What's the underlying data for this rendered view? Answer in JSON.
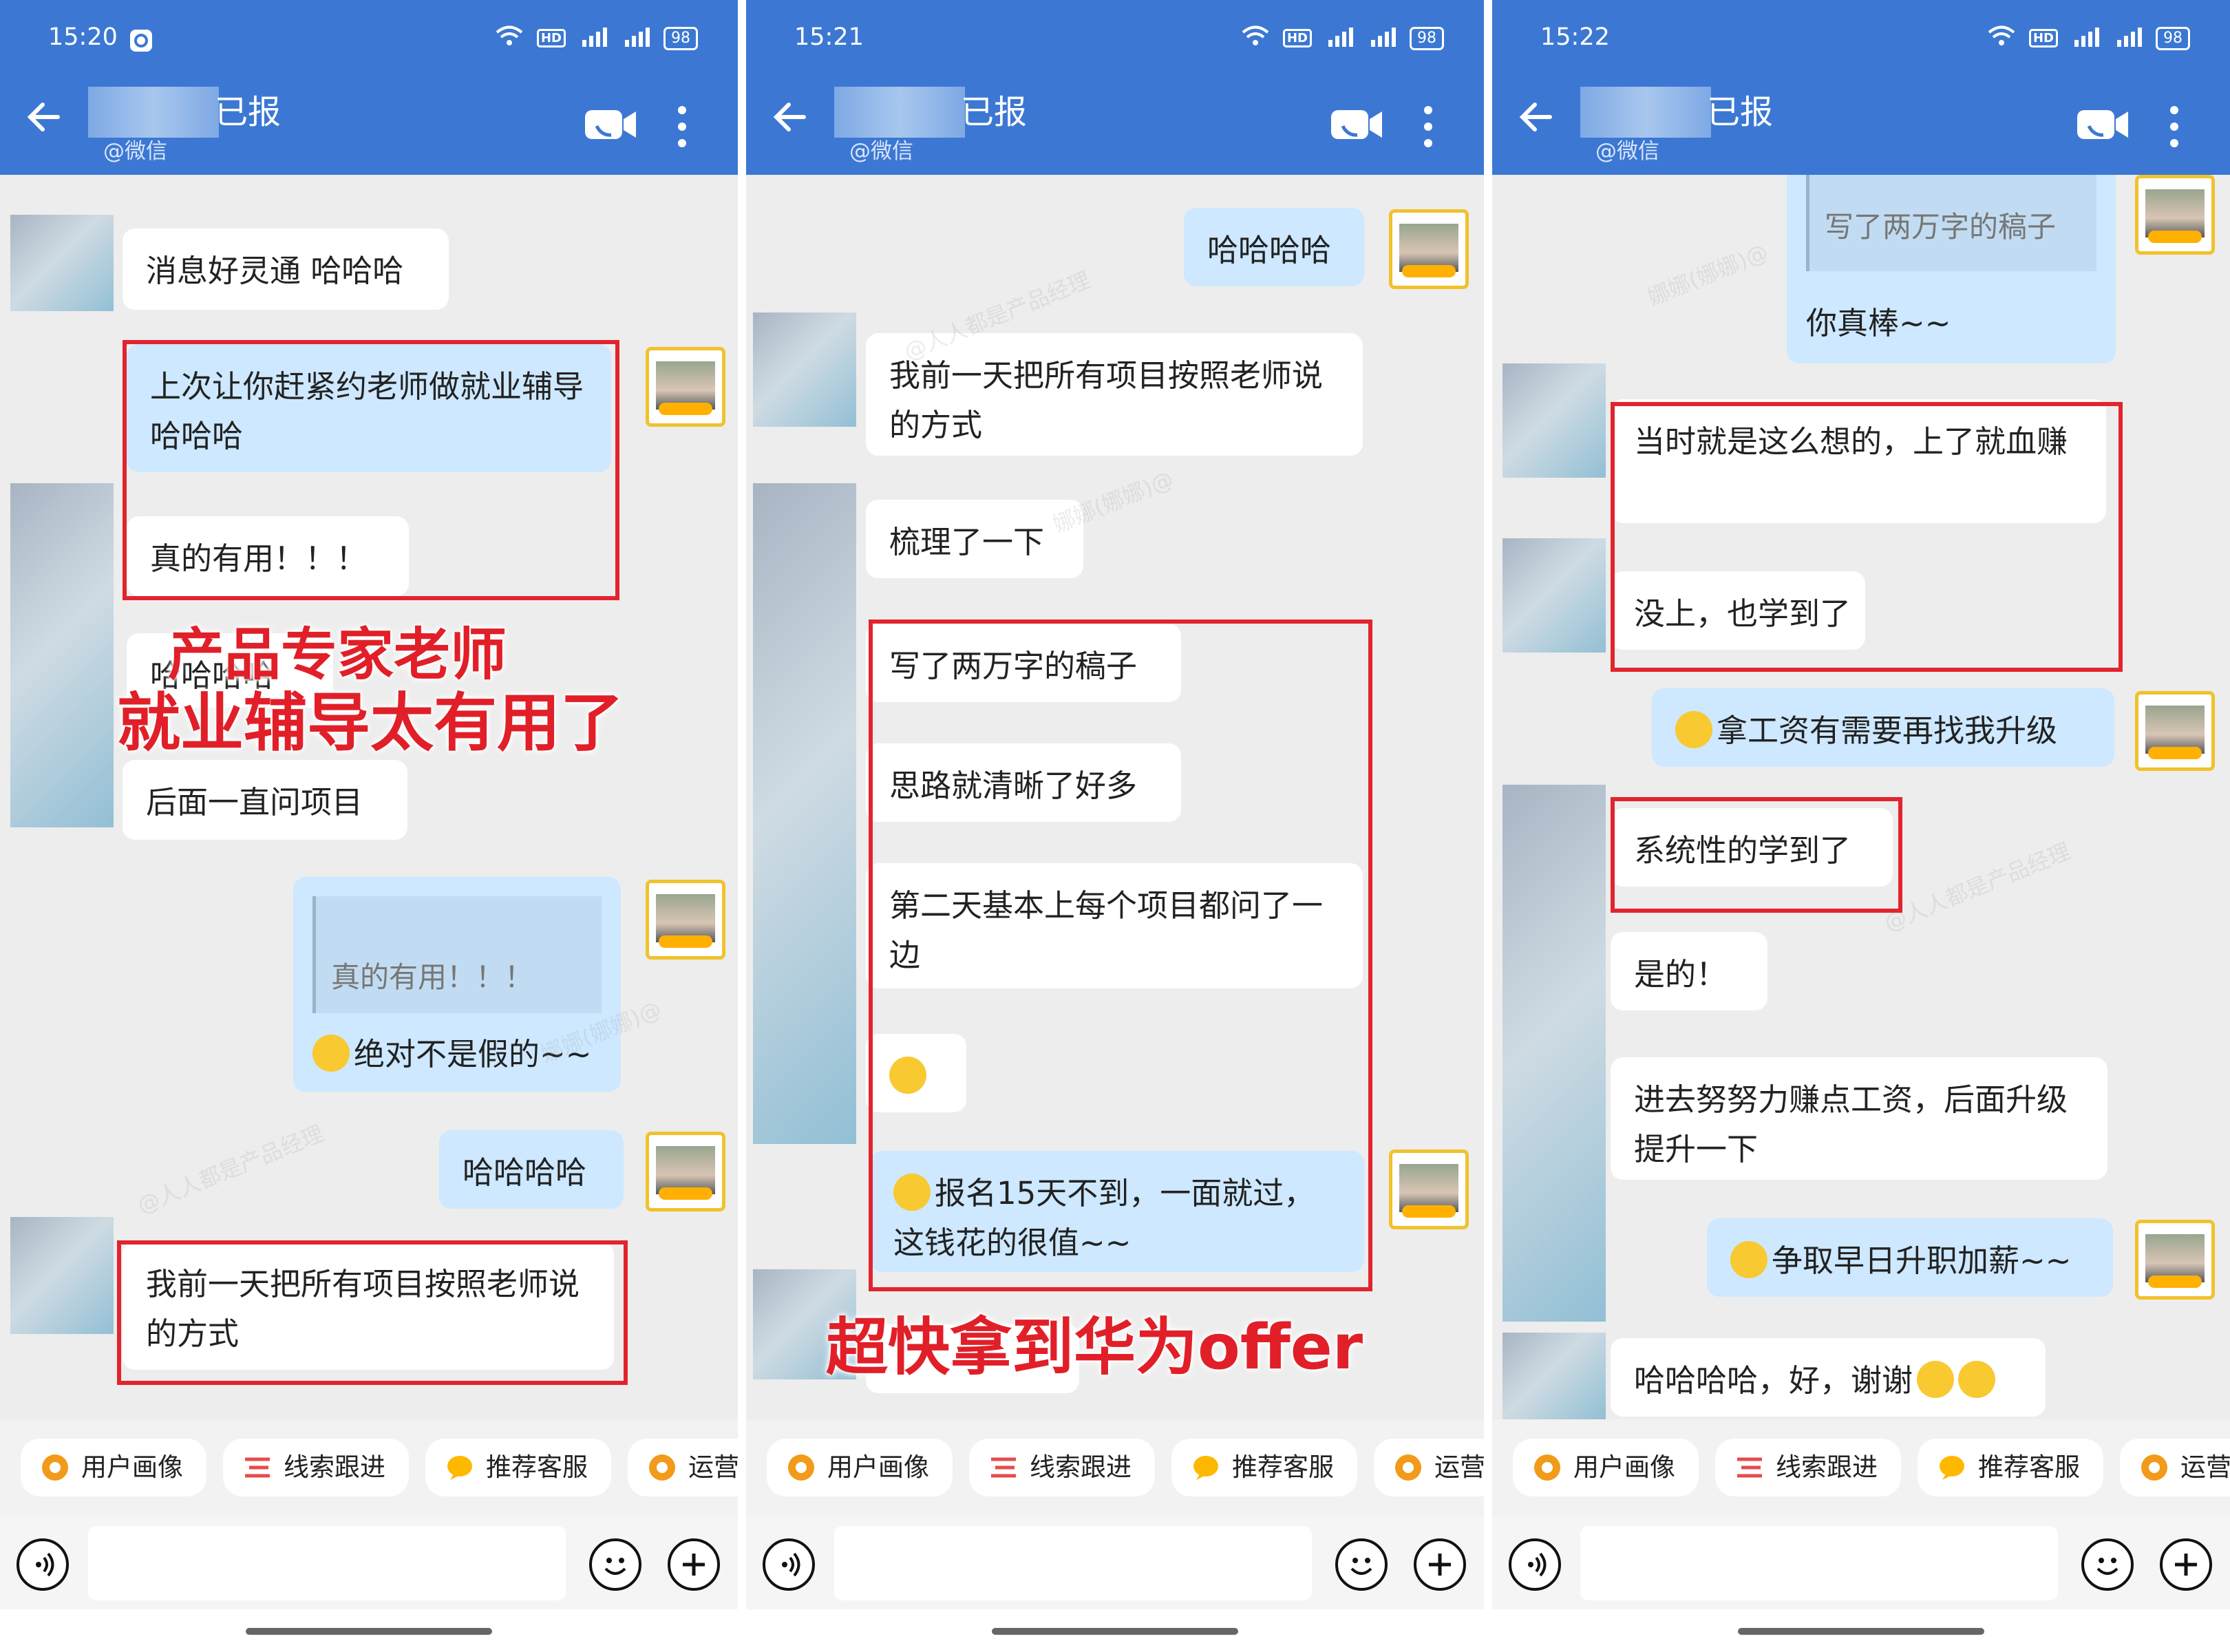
{
  "header": {
    "title": "已报",
    "subtitle": "@微信"
  },
  "panels": [
    {
      "time": "15:20",
      "battery": "98",
      "messages": [
        {
          "text": "消息好灵通 哈哈哈"
        },
        {
          "text": "上次让你赶紧约老师做就业辅导哈哈哈"
        },
        {
          "text": "真的有用！！！"
        },
        {
          "text": "哈哈哈哈"
        },
        {
          "text": "后面一直问项目"
        },
        {
          "quote": "真的有用！！！",
          "text": "绝对不是假的~~"
        },
        {
          "text": "哈哈哈哈"
        },
        {
          "text": "我前一天把所有项目按照老师说的方式"
        }
      ]
    },
    {
      "time": "15:21",
      "battery": "98",
      "messages": [
        {
          "text": "哈哈哈哈"
        },
        {
          "text": "我前一天把所有项目按照老师说的方式"
        },
        {
          "text": "梳理了一下"
        },
        {
          "text": "写了两万字的稿子"
        },
        {
          "text": "思路就清晰了好多"
        },
        {
          "text": "第二天基本上每个项目都问了一边"
        },
        {
          "text": "报名15天不到，一面就过，这钱花的很值~~"
        }
      ]
    },
    {
      "time": "15:22",
      "battery": "98",
      "messages": [
        {
          "quote": "写了两万字的稿子",
          "text": "你真棒~~"
        },
        {
          "text": "当时就是这么想的，上了就血赚"
        },
        {
          "text": "没上，也学到了"
        },
        {
          "text": "拿工资有需要再找我升级"
        },
        {
          "text": "系统性的学到了"
        },
        {
          "text": "是的！"
        },
        {
          "text": "进去努努力赚点工资，后面升级提升一下"
        },
        {
          "text": "争取早日升职加薪~~"
        },
        {
          "text": "哈哈哈哈，好，谢谢"
        }
      ]
    }
  ],
  "toolbar": {
    "chips": [
      "用户画像",
      "线索跟进",
      "推荐客服",
      "运营"
    ]
  },
  "overlay": {
    "line1": "产品专家老师",
    "line2": "就业辅导太有用了",
    "line3": "超快拿到华为offer"
  },
  "watermarks": [
    "@人人都是产品经理",
    "娜娜(娜娜)@"
  ]
}
